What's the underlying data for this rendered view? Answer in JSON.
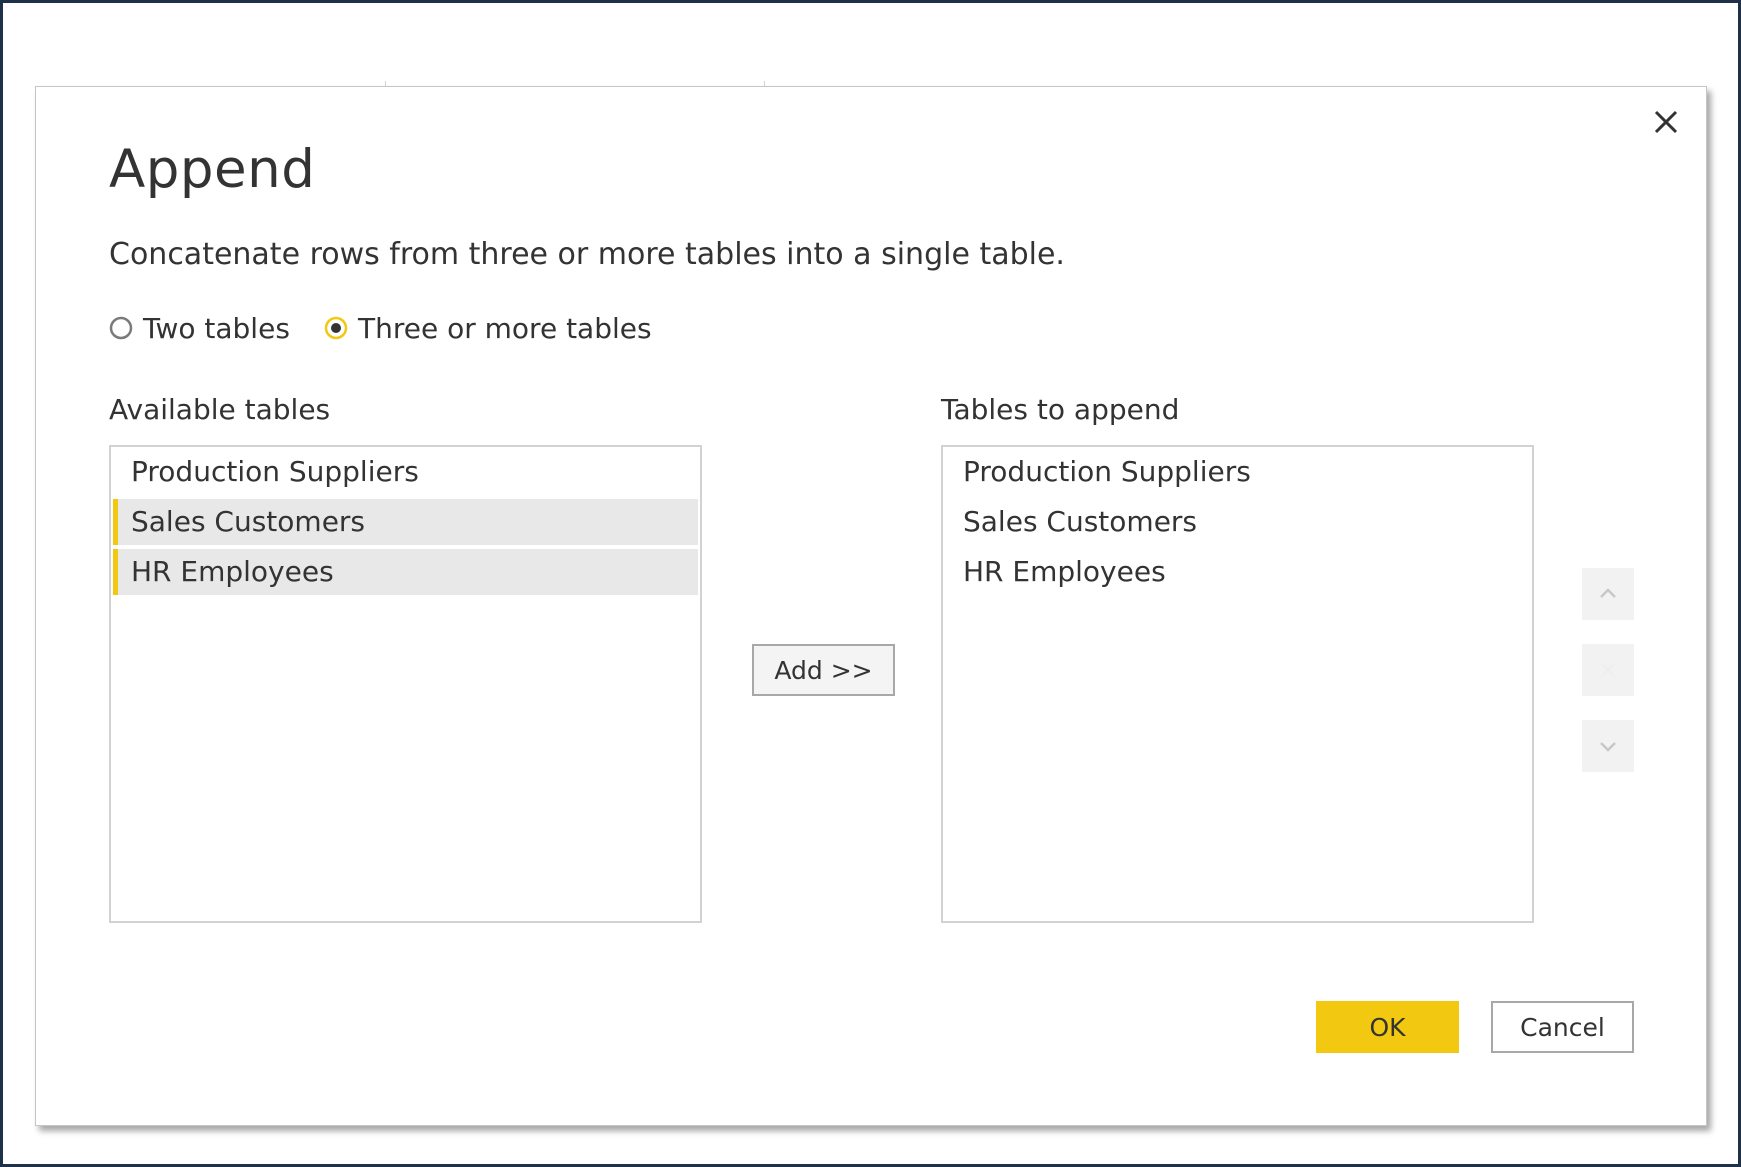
{
  "dialog": {
    "title": "Append",
    "description": "Concatenate rows from three or more tables into a single table."
  },
  "mode": {
    "options": [
      {
        "label": "Two tables",
        "selected": false
      },
      {
        "label": "Three or more tables",
        "selected": true
      }
    ]
  },
  "available": {
    "label": "Available tables",
    "items": [
      {
        "label": "Production Suppliers",
        "selected": false
      },
      {
        "label": "Sales Customers",
        "selected": true
      },
      {
        "label": "HR Employees",
        "selected": true
      }
    ]
  },
  "add_button": {
    "label": "Add >>"
  },
  "append": {
    "label": "Tables to append",
    "items": [
      {
        "label": "Production Suppliers"
      },
      {
        "label": "Sales Customers"
      },
      {
        "label": "HR Employees"
      }
    ]
  },
  "reorder": {
    "icons": [
      "chevron-up-icon",
      "remove-icon",
      "chevron-down-icon"
    ]
  },
  "footer": {
    "ok_label": "OK",
    "cancel_label": "Cancel"
  },
  "colors": {
    "accent": "#f2c811",
    "frame": "#1f3049",
    "selection": "#e8e8e8",
    "text": "#333333"
  },
  "icons": {
    "close": "close-icon",
    "radio_off": "radio-unchecked-icon",
    "radio_on": "radio-checked-icon"
  }
}
